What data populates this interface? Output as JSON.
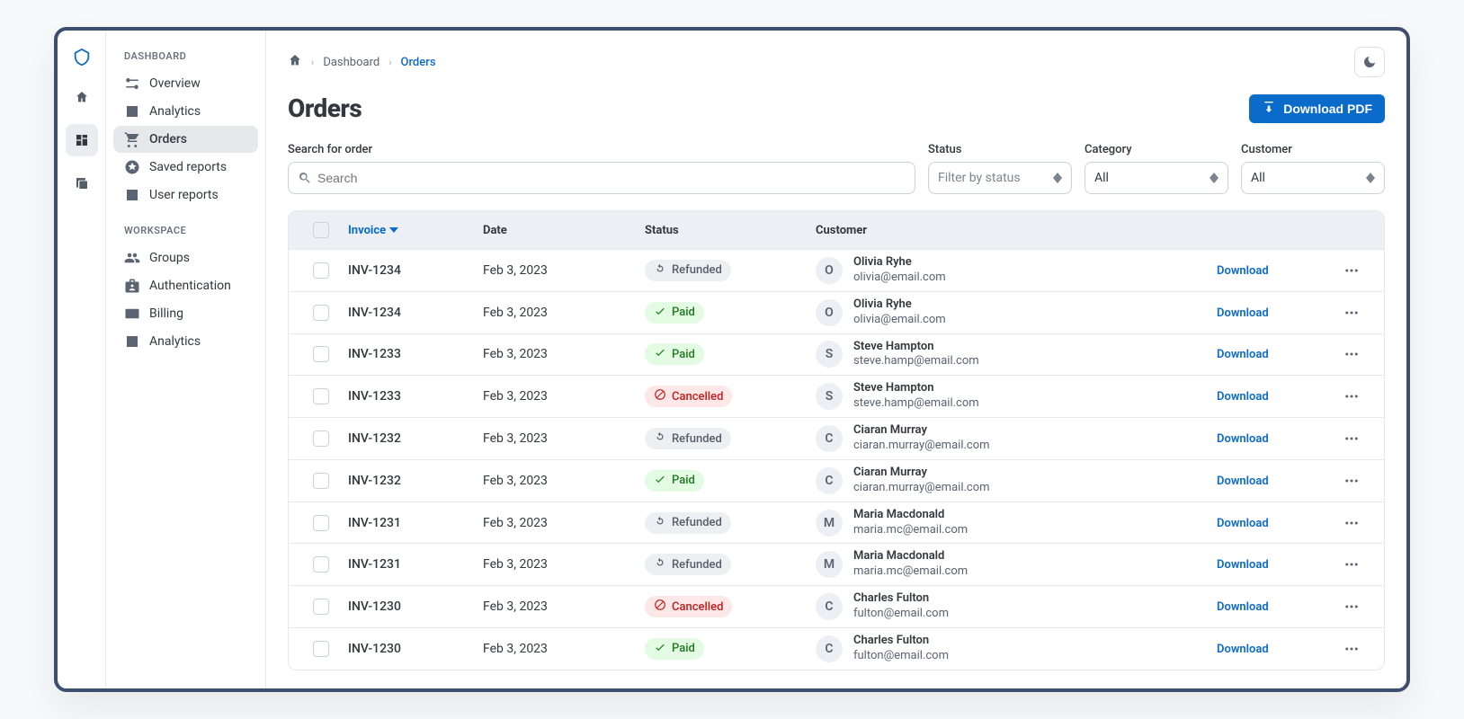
{
  "breadcrumb": {
    "item1": "Dashboard",
    "item2": "Orders"
  },
  "pageTitle": "Orders",
  "downloadPdfLabel": "Download PDF",
  "filters": {
    "searchLabel": "Search for order",
    "searchPlaceholder": "Search",
    "statusLabel": "Status",
    "statusPlaceholder": "Filter by status",
    "categoryLabel": "Category",
    "categoryValue": "All",
    "customerLabel": "Customer",
    "customerValue": "All"
  },
  "sidebarDashboard": {
    "label": "DASHBOARD",
    "items": [
      {
        "label": "Overview",
        "icon": "timeline"
      },
      {
        "label": "Analytics",
        "icon": "barchart"
      },
      {
        "label": "Orders",
        "icon": "cart",
        "active": true
      },
      {
        "label": "Saved reports",
        "icon": "star"
      },
      {
        "label": "User reports",
        "icon": "user"
      }
    ]
  },
  "sidebarWorkspace": {
    "label": "WORKSPACE",
    "items": [
      {
        "label": "Groups",
        "icon": "people"
      },
      {
        "label": "Authentication",
        "icon": "badge"
      },
      {
        "label": "Billing",
        "icon": "card"
      },
      {
        "label": "Analytics",
        "icon": "barchart"
      }
    ]
  },
  "columns": {
    "invoice": "Invoice",
    "date": "Date",
    "status": "Status",
    "customer": "Customer"
  },
  "rowDownloadLabel": "Download",
  "rows": [
    {
      "invoice": "INV-1234",
      "date": "Feb 3, 2023",
      "status": "Refunded",
      "statusKey": "refunded",
      "initial": "O",
      "name": "Olivia Ryhe",
      "email": "olivia@email.com"
    },
    {
      "invoice": "INV-1234",
      "date": "Feb 3, 2023",
      "status": "Paid",
      "statusKey": "paid",
      "initial": "O",
      "name": "Olivia Ryhe",
      "email": "olivia@email.com"
    },
    {
      "invoice": "INV-1233",
      "date": "Feb 3, 2023",
      "status": "Paid",
      "statusKey": "paid",
      "initial": "S",
      "name": "Steve Hampton",
      "email": "steve.hamp@email.com"
    },
    {
      "invoice": "INV-1233",
      "date": "Feb 3, 2023",
      "status": "Cancelled",
      "statusKey": "cancelled",
      "initial": "S",
      "name": "Steve Hampton",
      "email": "steve.hamp@email.com"
    },
    {
      "invoice": "INV-1232",
      "date": "Feb 3, 2023",
      "status": "Refunded",
      "statusKey": "refunded",
      "initial": "C",
      "name": "Ciaran Murray",
      "email": "ciaran.murray@email.com"
    },
    {
      "invoice": "INV-1232",
      "date": "Feb 3, 2023",
      "status": "Paid",
      "statusKey": "paid",
      "initial": "C",
      "name": "Ciaran Murray",
      "email": "ciaran.murray@email.com"
    },
    {
      "invoice": "INV-1231",
      "date": "Feb 3, 2023",
      "status": "Refunded",
      "statusKey": "refunded",
      "initial": "M",
      "name": "Maria Macdonald",
      "email": "maria.mc@email.com"
    },
    {
      "invoice": "INV-1231",
      "date": "Feb 3, 2023",
      "status": "Refunded",
      "statusKey": "refunded",
      "initial": "M",
      "name": "Maria Macdonald",
      "email": "maria.mc@email.com"
    },
    {
      "invoice": "INV-1230",
      "date": "Feb 3, 2023",
      "status": "Cancelled",
      "statusKey": "cancelled",
      "initial": "C",
      "name": "Charles Fulton",
      "email": "fulton@email.com"
    },
    {
      "invoice": "INV-1230",
      "date": "Feb 3, 2023",
      "status": "Paid",
      "statusKey": "paid",
      "initial": "C",
      "name": "Charles Fulton",
      "email": "fulton@email.com"
    }
  ]
}
